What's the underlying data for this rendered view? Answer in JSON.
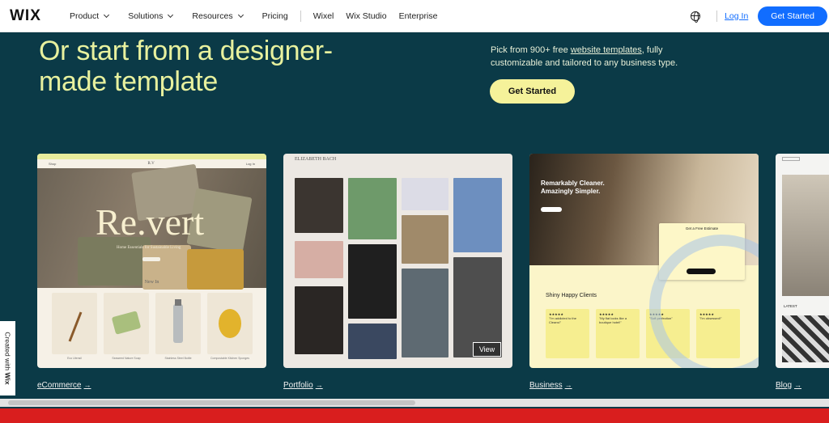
{
  "nav": {
    "logo": "WIX",
    "items": [
      "Product",
      "Solutions",
      "Resources",
      "Pricing",
      "Wixel",
      "Wix Studio",
      "Enterprise"
    ],
    "login": "Log In",
    "get_started": "Get Started"
  },
  "hero": {
    "title_line1": "Or start from a designer-",
    "title_line2": "made template",
    "desc_pre": "Pick from 900+ free ",
    "desc_link": "website templates",
    "desc_post": ", fully customizable and tailored to any business type.",
    "button": "Get Started"
  },
  "cards": {
    "ecommerce": {
      "caption": "eCommerce",
      "brand": "Re.vert",
      "sub": "Home Essentials for Sustainable Living",
      "new_in": "New In",
      "products": [
        "Eco Utensil",
        "Seaweed Nature Soap",
        "Stainless Steel Bottle",
        "Compostable Kitchen Sponges"
      ]
    },
    "portfolio": {
      "caption": "Portfolio",
      "name": "ELIZABETH BACH",
      "view": "View"
    },
    "business": {
      "caption": "Business",
      "headline": "Remarkably Cleaner. Amazingly Simpler.",
      "estimate": "Get a Free Estimate",
      "clients": "Shiny Happy Clients",
      "reviews": [
        "\"I'm addicted to the Cleans!\"",
        "\"My flat looks like a boutique hotel!\"",
        "\"Soft perfection\"",
        "\"I'm obsessed!\""
      ]
    },
    "blog": {
      "caption": "Blog",
      "latest": "LATEST"
    }
  },
  "badge": {
    "pre": "Created with ",
    "brand": "Wix"
  },
  "arrow": "→"
}
